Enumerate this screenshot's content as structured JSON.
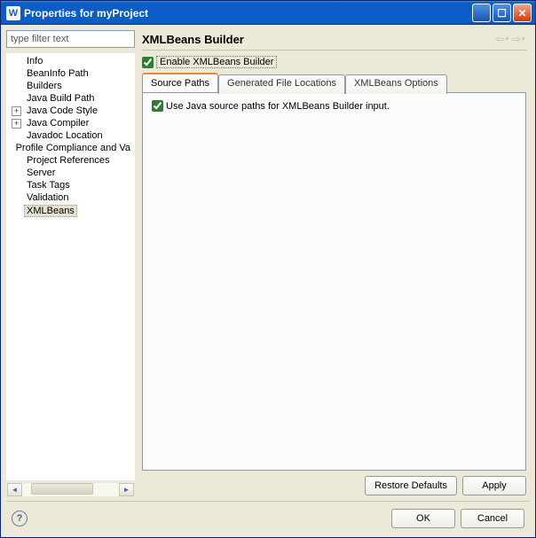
{
  "window": {
    "title": "Properties for myProject",
    "icon_letter": "W"
  },
  "sidebar": {
    "filter_placeholder": "type filter text",
    "items": [
      {
        "label": "Info",
        "expandable": false
      },
      {
        "label": "BeanInfo Path",
        "expandable": false
      },
      {
        "label": "Builders",
        "expandable": false
      },
      {
        "label": "Java Build Path",
        "expandable": false
      },
      {
        "label": "Java Code Style",
        "expandable": true
      },
      {
        "label": "Java Compiler",
        "expandable": true
      },
      {
        "label": "Javadoc Location",
        "expandable": false
      },
      {
        "label": "Profile Compliance and Va",
        "expandable": false
      },
      {
        "label": "Project References",
        "expandable": false
      },
      {
        "label": "Server",
        "expandable": false
      },
      {
        "label": "Task Tags",
        "expandable": false
      },
      {
        "label": "Validation",
        "expandable": false
      },
      {
        "label": "XMLBeans",
        "expandable": false,
        "selected": true
      }
    ]
  },
  "content": {
    "title": "XMLBeans Builder",
    "enable_label": "Enable XMLBeans Builder",
    "enable_checked": true,
    "tabs": [
      {
        "label": "Source Paths",
        "active": true
      },
      {
        "label": "Generated File Locations",
        "active": false
      },
      {
        "label": "XMLBeans Options",
        "active": false
      }
    ],
    "option_label": "Use Java source paths for XMLBeans Builder input.",
    "option_checked": true
  },
  "buttons": {
    "restore_defaults": "Restore Defaults",
    "apply": "Apply",
    "ok": "OK",
    "cancel": "Cancel"
  }
}
